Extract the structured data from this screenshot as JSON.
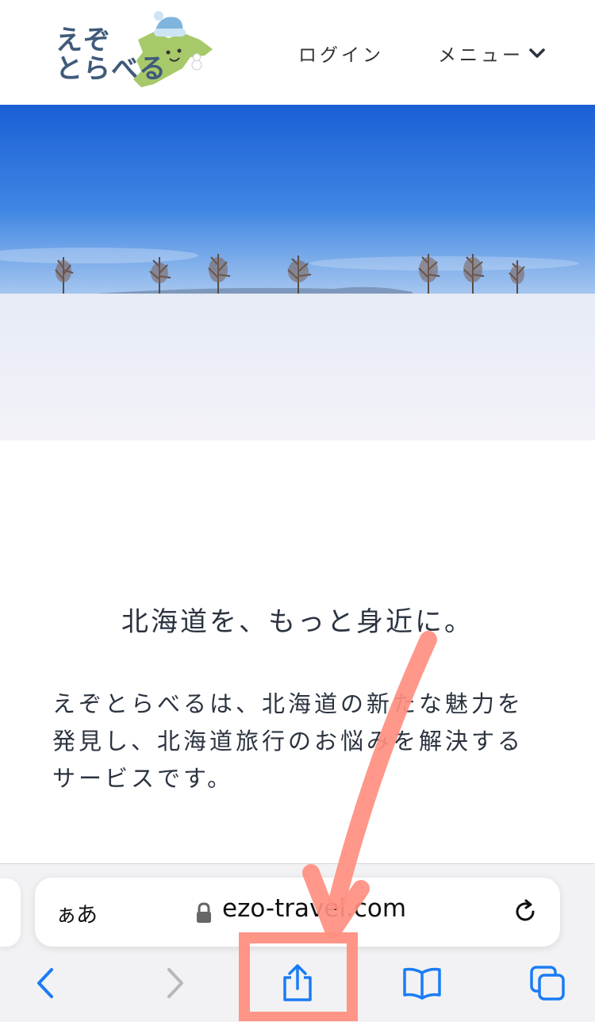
{
  "header": {
    "logo_line1": "えぞ",
    "logo_line2": "とらべる",
    "login_label": "ログイン",
    "menu_label": "メニュー",
    "menu_icon": "chevron-down-icon"
  },
  "hero": {
    "image": "snowy-field-with-trees"
  },
  "main": {
    "headline": "北海道を、もっと身近に。",
    "intro": "えぞとらべるは、北海道の新たな魅力を発見し、北海道旅行のお悩みを解決するサービスです。"
  },
  "browser": {
    "text_size_label": "ぁあ",
    "url": "ezo-travel.com",
    "lock_icon": "lock-icon",
    "reload_icon": "reload-icon",
    "toolbar": {
      "back_icon": "chevron-left-icon",
      "forward_icon": "chevron-right-icon",
      "share_icon": "share-icon",
      "bookmarks_icon": "book-icon",
      "tabs_icon": "tabs-icon"
    }
  },
  "colors": {
    "ios_blue": "#1a7cf5",
    "annotation_salmon": "#ff8f80",
    "text": "#2b3340"
  }
}
